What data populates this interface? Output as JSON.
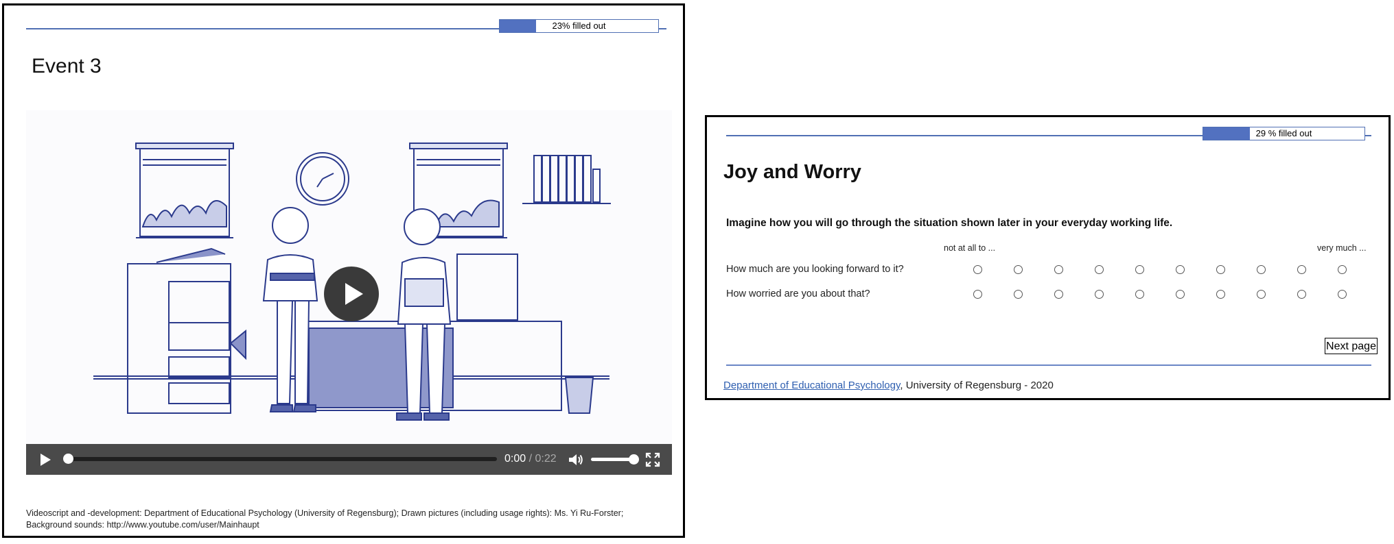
{
  "event_page": {
    "progress": {
      "label": "23% filled out",
      "percent": 23
    },
    "title": "Event 3",
    "video": {
      "current_time": "0:00",
      "separator": "/",
      "duration": "0:22",
      "volume_percent": 100
    },
    "credits": {
      "line1": "Videoscript and -development:  Department  of Educational Psychology (University of Regensburg);  Drawn pictures (including usage rights): Ms. Yi Ru-Forster;",
      "line2": "Background sounds: http://www.youtube.com/user/Mainhaupt"
    },
    "icons": [
      "play-icon",
      "volume-icon",
      "fullscreen-icon"
    ]
  },
  "questionnaire_page": {
    "progress": {
      "label": "29 % filled out",
      "percent": 29
    },
    "title": "Joy and Worry",
    "instruction": "Imagine how you will go through the situation shown later in your everyday working life.",
    "scale": {
      "low_label": "not at all to ...",
      "high_label": "very much ...",
      "points": 10
    },
    "questions": [
      {
        "label": "How much are you looking forward to it?"
      },
      {
        "label": "How worried are you about that?"
      }
    ],
    "next_button": "Next page",
    "footer": {
      "link": "Department  of Educational  Psychology",
      "text": ", University  of Regensburg  - 2020"
    }
  },
  "colors": {
    "accent": "#5271c0",
    "rule": "#4f6fb3",
    "player_bar": "#4a4a4a",
    "link": "#2f5fb0"
  }
}
